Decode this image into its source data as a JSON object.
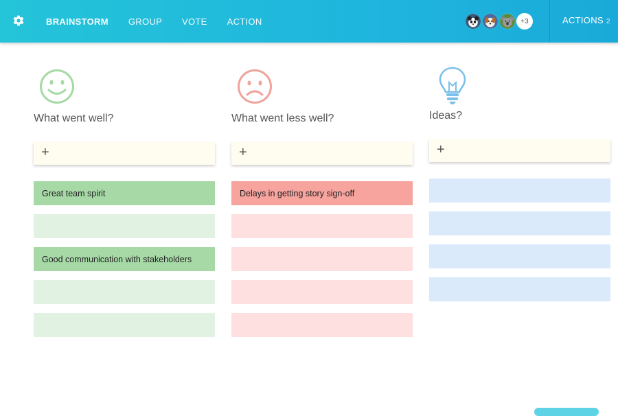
{
  "nav": {
    "settings_icon": "gear-icon",
    "items": [
      {
        "label": "BRAINSTORM",
        "active": true
      },
      {
        "label": "GROUP",
        "active": false
      },
      {
        "label": "VOTE",
        "active": false
      },
      {
        "label": "ACTION",
        "active": false
      }
    ]
  },
  "participants": {
    "avatars": [
      "panda-avatar",
      "dog-avatar",
      "koala-avatar"
    ],
    "more_label": "+3"
  },
  "actions": {
    "label": "ACTIONS",
    "count": "2"
  },
  "columns": [
    {
      "icon": "smiley-face-icon",
      "title": "What went well?",
      "add_icon": "plus-icon",
      "color": "#a6d9a6",
      "cards": [
        {
          "text": "Great team spirit",
          "filled": true
        },
        {
          "text": "",
          "filled": false
        },
        {
          "text": "Good communication with stakeholders",
          "filled": true
        },
        {
          "text": "",
          "filled": false
        },
        {
          "text": "",
          "filled": false
        }
      ]
    },
    {
      "icon": "sad-face-icon",
      "title": "What went less well?",
      "add_icon": "plus-icon",
      "color": "#f7a39e",
      "cards": [
        {
          "text": "Delays in getting story sign-off",
          "filled": true
        },
        {
          "text": "",
          "filled": false
        },
        {
          "text": "",
          "filled": false
        },
        {
          "text": "",
          "filled": false
        },
        {
          "text": "",
          "filled": false
        }
      ]
    },
    {
      "icon": "lightbulb-icon",
      "title": "Ideas?",
      "add_icon": "plus-icon",
      "color": "#daeafb",
      "cards": [
        {
          "text": "",
          "filled": false
        },
        {
          "text": "",
          "filled": false
        },
        {
          "text": "",
          "filled": false
        },
        {
          "text": "",
          "filled": false
        }
      ]
    }
  ],
  "add_symbol": "+"
}
